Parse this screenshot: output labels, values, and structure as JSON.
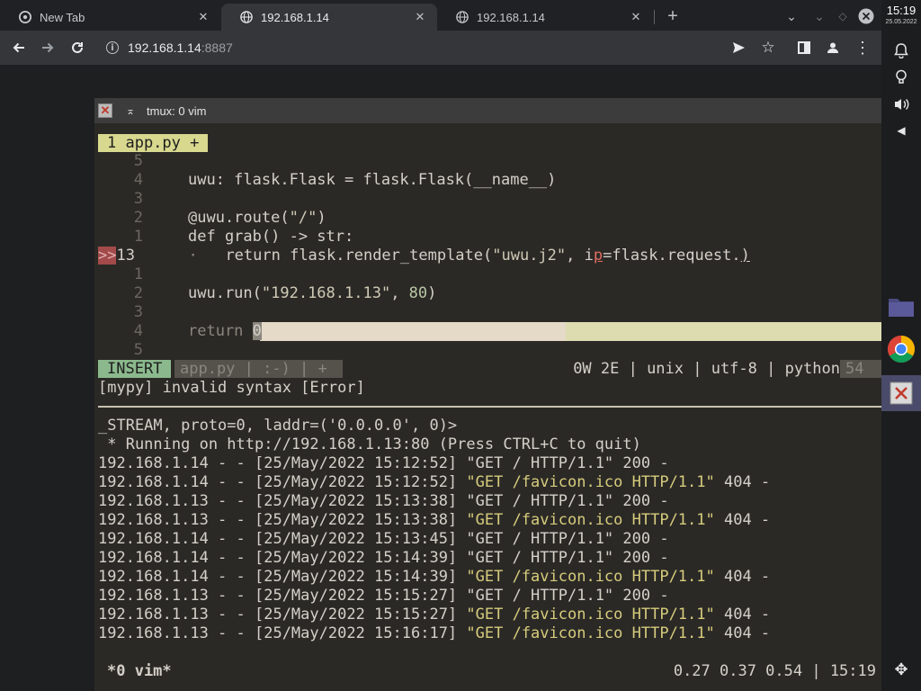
{
  "browser": {
    "tabs": [
      {
        "label": "New Tab"
      },
      {
        "label": "192.168.1.14"
      },
      {
        "label": "192.168.1.14"
      }
    ],
    "address": {
      "host": "192.168.1.14",
      "port": ":8887"
    }
  },
  "dock": {
    "time": "15:19",
    "date": "25.05.2022"
  },
  "terminal": {
    "title": "tmux: 0 vim",
    "buffer_tab": "1 app.py +",
    "code_lines": [
      {
        "num": "5",
        "text": ""
      },
      {
        "num": "4",
        "text": "uwu: flask.Flask = flask.Flask(__name__)"
      },
      {
        "num": "3",
        "text": ""
      },
      {
        "num": "2",
        "text": "@uwu.route(\"/\")"
      },
      {
        "num": "1",
        "text": "def grab() -> str:"
      },
      {
        "num": "13",
        "sign": ">>",
        "text": "    return flask.render_template(\"uwu.j2\", ip=flask.request.)"
      },
      {
        "num": "1",
        "text": ""
      },
      {
        "num": "2",
        "text": "uwu.run(\"192.168.1.13\", 80)"
      },
      {
        "num": "3",
        "text": ""
      },
      {
        "num": "4",
        "text": "return 0"
      },
      {
        "num": "5",
        "text": ""
      }
    ],
    "status": {
      "mode": "INSERT",
      "file": "app.py | :-) | +",
      "stats": "0W 2E | unix | utf-8 | python",
      "percent": "54"
    },
    "message": "[mypy] invalid syntax [Error]",
    "log_lines": [
      "_STREAM, proto=0, laddr=('0.0.0.0', 0)>",
      " * Running on http://192.168.1.13:80 (Press CTRL+C to quit)"
    ],
    "requests": [
      {
        "ip": "192.168.1.14",
        "ts": "25/May/2022 15:12:52",
        "req": "\"GET / HTTP/1.1\"",
        "status": "200 -",
        "warn": false
      },
      {
        "ip": "192.168.1.14",
        "ts": "25/May/2022 15:12:52",
        "req": "\"GET /favicon.ico HTTP/1.1\"",
        "status": "404 -",
        "warn": true
      },
      {
        "ip": "192.168.1.13",
        "ts": "25/May/2022 15:13:38",
        "req": "\"GET / HTTP/1.1\"",
        "status": "200 -",
        "warn": false
      },
      {
        "ip": "192.168.1.13",
        "ts": "25/May/2022 15:13:38",
        "req": "\"GET /favicon.ico HTTP/1.1\"",
        "status": "404 -",
        "warn": true
      },
      {
        "ip": "192.168.1.14",
        "ts": "25/May/2022 15:13:45",
        "req": "\"GET / HTTP/1.1\"",
        "status": "200 -",
        "warn": false
      },
      {
        "ip": "192.168.1.14",
        "ts": "25/May/2022 15:14:39",
        "req": "\"GET / HTTP/1.1\"",
        "status": "200 -",
        "warn": false
      },
      {
        "ip": "192.168.1.14",
        "ts": "25/May/2022 15:14:39",
        "req": "\"GET /favicon.ico HTTP/1.1\"",
        "status": "404 -",
        "warn": true
      },
      {
        "ip": "192.168.1.13",
        "ts": "25/May/2022 15:15:27",
        "req": "\"GET / HTTP/1.1\"",
        "status": "200 -",
        "warn": false
      },
      {
        "ip": "192.168.1.13",
        "ts": "25/May/2022 15:15:27",
        "req": "\"GET /favicon.ico HTTP/1.1\"",
        "status": "404 -",
        "warn": true
      },
      {
        "ip": "192.168.1.13",
        "ts": "25/May/2022 15:16:17",
        "req": "\"GET /favicon.ico HTTP/1.1\"",
        "status": "404 -",
        "warn": true
      }
    ],
    "tmux": {
      "window": "*0 vim*",
      "right": "0.27 0.37 0.54 | 15:19"
    }
  }
}
